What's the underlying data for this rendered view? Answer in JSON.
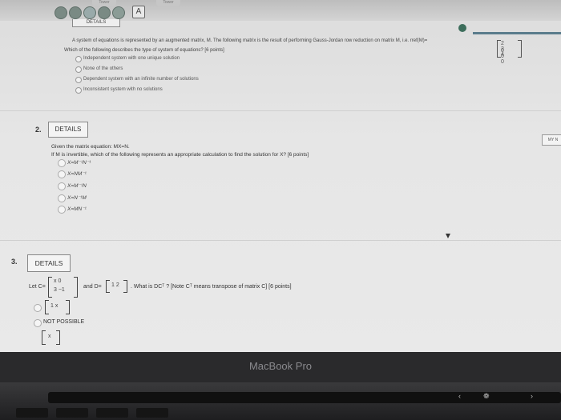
{
  "browser": {
    "tab_labels": [
      "Tower",
      "Tower"
    ],
    "a_button": "A"
  },
  "question1": {
    "details_label": "DETAILS",
    "stem_line1": "A system of equations is represented by an augmented matrix, M. The following matrix is the result of performing Gauss-Jordan row reduction on matrix M, i.e. rref(M)=",
    "stem_line2": "Which of the following describes the type of system of equations? [6 points]",
    "options": [
      "Independent system with one unique solution",
      "None of the others",
      "Dependent system with an infinite number of solutions",
      "Inconsistent system with no solutions"
    ],
    "matrix_row1": "2 3 4",
    "matrix_row2": "0 0 0"
  },
  "question2": {
    "number": "2.",
    "details_label": "DETAILS",
    "side_label": "MY N",
    "stem_line1": "Given the matrix equation: MX=N.",
    "stem_line2": "If M is invertible, which of the following represents an appropriate calculation to find the solution for X? [6 points]",
    "options": [
      "X=M⁻¹N⁻¹",
      "X=NM⁻¹",
      "X=M⁻¹N",
      "X=N⁻¹M",
      "X=MN⁻¹"
    ]
  },
  "question3": {
    "number": "3.",
    "details_label": "DETAILS",
    "let_c": "Let C=",
    "c_row1": "x  0",
    "c_row2": "3  −1",
    "and_d": "and D=",
    "d_row": "1  2",
    "question": ". What is DCᵀ ? [Note Cᵀ means transpose of matrix C] [6 points]",
    "option_a_matrix": "1  x",
    "option_b": "NOT POSSIBLE",
    "option_c_matrix": "x"
  },
  "laptop": {
    "brand": "MacBook Pro"
  },
  "colors": {
    "screen_bg": "#e6e6e6",
    "bezel": "#2a2a2c",
    "accent_bar": "#5a7c8c"
  }
}
